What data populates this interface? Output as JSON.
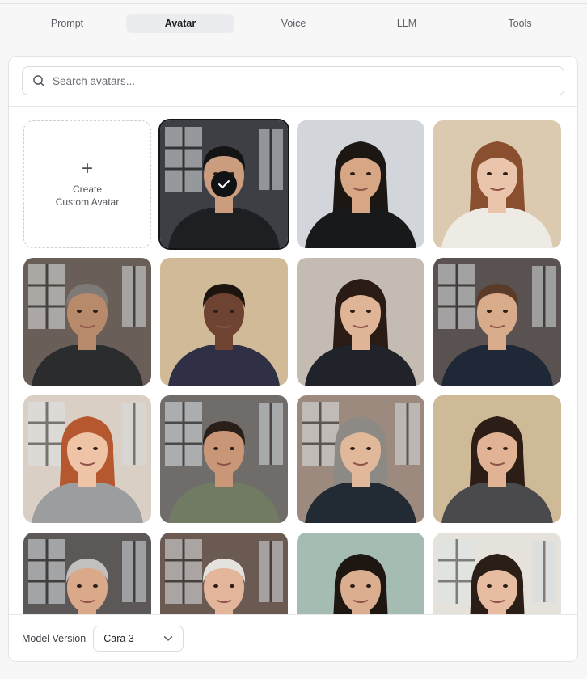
{
  "tabs": [
    {
      "label": "Prompt",
      "active": false
    },
    {
      "label": "Avatar",
      "active": true
    },
    {
      "label": "Voice",
      "active": false
    },
    {
      "label": "LLM",
      "active": false
    },
    {
      "label": "Tools",
      "active": false
    }
  ],
  "search": {
    "placeholder": "Search avatars...",
    "value": "",
    "icon": "search-icon"
  },
  "create_avatar": {
    "line1": "Create",
    "line2": "Custom Avatar",
    "icon": "plus-icon"
  },
  "selected_avatar_index": 0,
  "avatars": [
    {
      "id": "avatar-1",
      "bg": "#3d3f44",
      "window": true,
      "skin": "#c99d7e",
      "hair": "#141414",
      "shirt": "#1d1f22",
      "long_hair": false
    },
    {
      "id": "avatar-2",
      "bg": "#cfd2d6",
      "window": false,
      "skin": "#d6a685",
      "hair": "#1d1713",
      "shirt": "#18191b",
      "long_hair": true
    },
    {
      "id": "avatar-3",
      "bg": "#d8c6aa",
      "window": false,
      "skin": "#eac5ab",
      "hair": "#8a4f2e",
      "shirt": "#eeeae4",
      "long_hair": true
    },
    {
      "id": "avatar-4",
      "bg": "#6a5f58",
      "window": true,
      "skin": "#b88a6c",
      "hair": "#7d7a77",
      "shirt": "#2b2c2e",
      "long_hair": false
    },
    {
      "id": "avatar-5",
      "bg": "#cdb58f",
      "window": false,
      "skin": "#6e4331",
      "hair": "#1e140f",
      "shirt": "#2f2f45",
      "long_hair": false
    },
    {
      "id": "avatar-6",
      "bg": "#bfb7ad",
      "window": false,
      "skin": "#e0b497",
      "hair": "#2a1c15",
      "shirt": "#20232a",
      "long_hair": true
    },
    {
      "id": "avatar-7",
      "bg": "#5a5250",
      "window": true,
      "skin": "#d8ab8b",
      "hair": "#5a3b28",
      "shirt": "#1f2836",
      "long_hair": false
    },
    {
      "id": "avatar-8",
      "bg": "#d9cfc4",
      "window": true,
      "skin": "#eec3a6",
      "hair": "#b5572f",
      "shirt": "#9b9d9f",
      "long_hair": true
    },
    {
      "id": "avatar-9",
      "bg": "#6f6c6a",
      "window": true,
      "skin": "#c99777",
      "hair": "#2a1f18",
      "shirt": "#717a62",
      "long_hair": false
    },
    {
      "id": "avatar-10",
      "bg": "#9c8a7e",
      "window": true,
      "skin": "#e2b89b",
      "hair": "#8d8a86",
      "shirt": "#222a33",
      "long_hair": true
    },
    {
      "id": "avatar-11",
      "bg": "#cbb590",
      "window": false,
      "skin": "#e1b394",
      "hair": "#2c1e16",
      "shirt": "#4a4a4c",
      "long_hair": true
    },
    {
      "id": "avatar-12",
      "bg": "#5b5857",
      "window": true,
      "skin": "#d9a98a",
      "hair": "#c2c0bd",
      "shirt": "#25272c",
      "long_hair": false
    },
    {
      "id": "avatar-13",
      "bg": "#6b5a52",
      "window": true,
      "skin": "#e3b59a",
      "hair": "#e4e2de",
      "shirt": "#1e2a3c",
      "long_hair": false
    },
    {
      "id": "avatar-14",
      "bg": "#9db7ac",
      "window": false,
      "skin": "#dcae90",
      "hair": "#1e1611",
      "shirt": "#3a3a3a",
      "long_hair": true
    },
    {
      "id": "avatar-15",
      "bg": "#e5e2dc",
      "window": true,
      "skin": "#e7bca0",
      "hair": "#2a1e16",
      "shirt": "#5a5a5a",
      "long_hair": true
    }
  ],
  "footer": {
    "label": "Model Version",
    "model_value": "Cara 3",
    "dropdown_icon": "chevron-down-icon"
  }
}
